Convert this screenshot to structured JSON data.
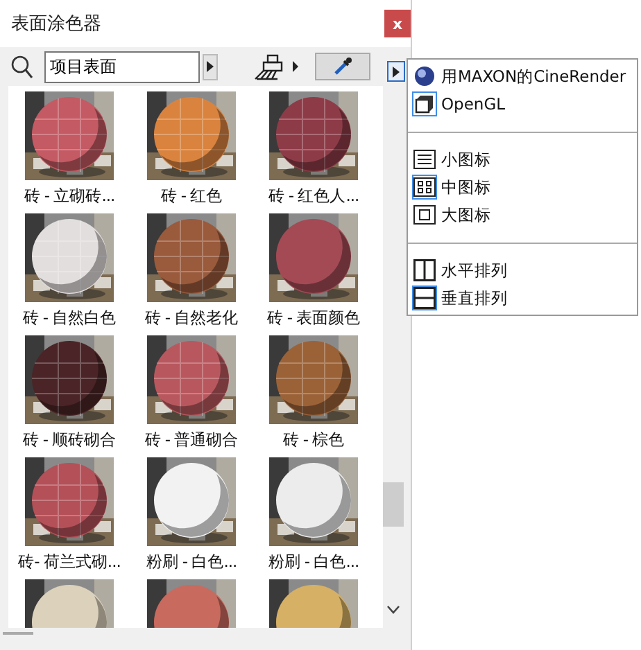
{
  "window": {
    "title": "表面涂色器",
    "close_label": "x"
  },
  "toolbar": {
    "search": {
      "value": "项目表面"
    }
  },
  "materials": [
    {
      "kind": "picture",
      "label": "砖 - 立砌砖..."
    },
    {
      "kind": "picture",
      "label": "砖 - 红色"
    },
    {
      "kind": "picture",
      "label": "砖 - 红色人..."
    },
    {
      "kind": "picture",
      "label": "砖 - 自然白色"
    },
    {
      "kind": "picture",
      "label": "砖 - 自然老化"
    },
    {
      "kind": "picture",
      "label": "砖 - 表面颜色"
    },
    {
      "kind": "picture",
      "label": "砖 - 顺砖砌合"
    },
    {
      "kind": "picture",
      "label": "砖 - 普通砌合"
    },
    {
      "kind": "picture",
      "label": "砖 - 棕色"
    },
    {
      "kind": "picture",
      "label": "砖- 荷兰式砌..."
    },
    {
      "kind": "picture",
      "label": "粉刷 - 白色..."
    },
    {
      "kind": "picture",
      "label": "粉刷 - 白色..."
    },
    {
      "kind": "picture"
    },
    {
      "kind": "picture"
    },
    {
      "kind": "picture"
    }
  ],
  "view_menu": {
    "items": [
      {
        "kind": "option",
        "label": "用MAXON的CineRender",
        "selected": false
      },
      {
        "kind": "option",
        "label": "OpenGL",
        "selected": true
      },
      {
        "kind": "separator"
      },
      {
        "kind": "option",
        "label": "小图标",
        "selected": false
      },
      {
        "kind": "option",
        "label": "中图标",
        "selected": true
      },
      {
        "kind": "option",
        "label": "大图标",
        "selected": false
      },
      {
        "kind": "separator"
      },
      {
        "kind": "option",
        "label": "水平排列",
        "selected": false
      },
      {
        "kind": "option",
        "label": "垂直排列",
        "selected": true
      }
    ]
  }
}
